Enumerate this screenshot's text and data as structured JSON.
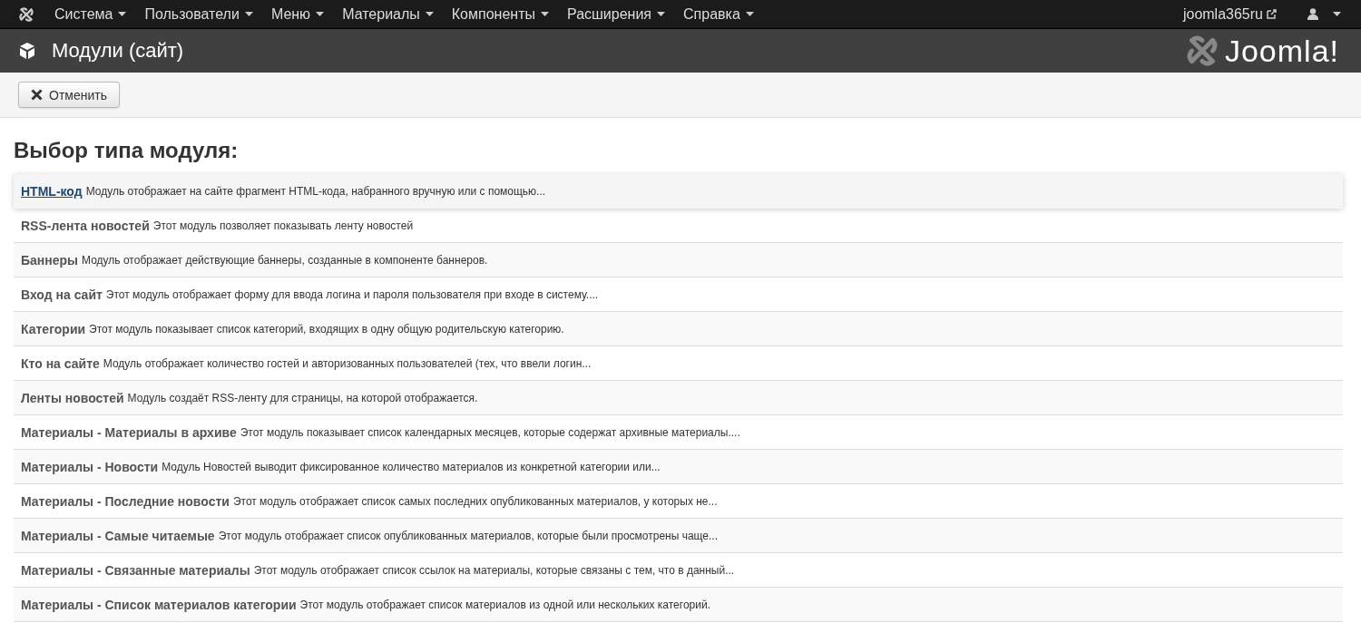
{
  "navbar": {
    "menus": [
      {
        "label": "Система"
      },
      {
        "label": "Пользователи"
      },
      {
        "label": "Меню"
      },
      {
        "label": "Материалы"
      },
      {
        "label": "Компоненты"
      },
      {
        "label": "Расширения"
      },
      {
        "label": "Справка"
      }
    ],
    "site_link": "joomla365ru"
  },
  "header": {
    "title": "Модули (сайт)",
    "logo_text": "Joomla!"
  },
  "toolbar": {
    "buttons": [
      {
        "label": "Отменить"
      }
    ]
  },
  "heading": "Выбор типа модуля:",
  "modules": [
    {
      "title": "HTML-код",
      "description": "Модуль отображает на сайте фрагмент HTML-кода, набранного вручную или с помощью...",
      "selected": true
    },
    {
      "title": "RSS-лента новостей",
      "description": "Этот модуль позволяет показывать ленту новостей",
      "selected": false
    },
    {
      "title": "Баннеры",
      "description": "Модуль отображает действующие баннеры, созданные в компоненте баннеров.",
      "selected": false
    },
    {
      "title": "Вход на сайт",
      "description": "Этот модуль отображает форму для ввода логина и пароля пользователя при входе в систему....",
      "selected": false
    },
    {
      "title": "Категории",
      "description": "Этот модуль показывает список категорий, входящих в одну общую родительскую категорию.",
      "selected": false
    },
    {
      "title": "Кто на сайте",
      "description": "Модуль отображает количество гостей и авторизованных пользователей (тех, что ввели логин...",
      "selected": false
    },
    {
      "title": "Ленты новостей",
      "description": "Модуль создаёт RSS-ленту для страницы, на которой отображается.",
      "selected": false
    },
    {
      "title": "Материалы - Материалы в архиве",
      "description": "Этот модуль показывает список календарных месяцев, которые содержат архивные материалы....",
      "selected": false
    },
    {
      "title": "Материалы - Новости",
      "description": "Модуль Новостей выводит фиксированное количество материалов из конкретной категории или...",
      "selected": false
    },
    {
      "title": "Материалы - Последние новости",
      "description": "Этот модуль отображает список самых последних опубликованных материалов, у которых не...",
      "selected": false
    },
    {
      "title": "Материалы - Самые читаемые",
      "description": "Этот модуль отображает список опубликованных материалов, которые были просмотрены чаще...",
      "selected": false
    },
    {
      "title": "Материалы - Связанные материалы",
      "description": "Этот модуль отображает список ссылок на материалы, которые связаны с тем, что в данный...",
      "selected": false
    },
    {
      "title": "Материалы - Список материалов категории",
      "description": "Этот модуль отображает список материалов из одной или нескольких категорий.",
      "selected": false
    }
  ]
}
